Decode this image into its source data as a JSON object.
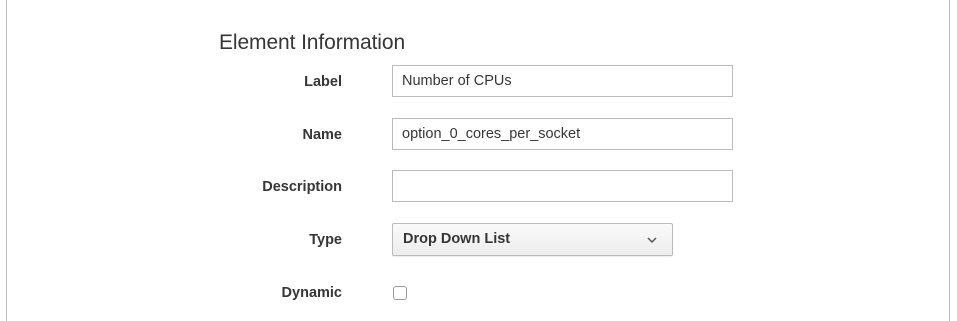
{
  "section": {
    "title": "Element Information"
  },
  "fields": {
    "label": {
      "label": "Label",
      "value": "Number of CPUs"
    },
    "name": {
      "label": "Name",
      "value": "option_0_cores_per_socket"
    },
    "description": {
      "label": "Description",
      "value": ""
    },
    "type": {
      "label": "Type",
      "selected": "Drop Down List"
    },
    "dynamic": {
      "label": "Dynamic",
      "checked": false
    }
  },
  "icons": {
    "type_dropdown": "chevron-down-icon"
  }
}
